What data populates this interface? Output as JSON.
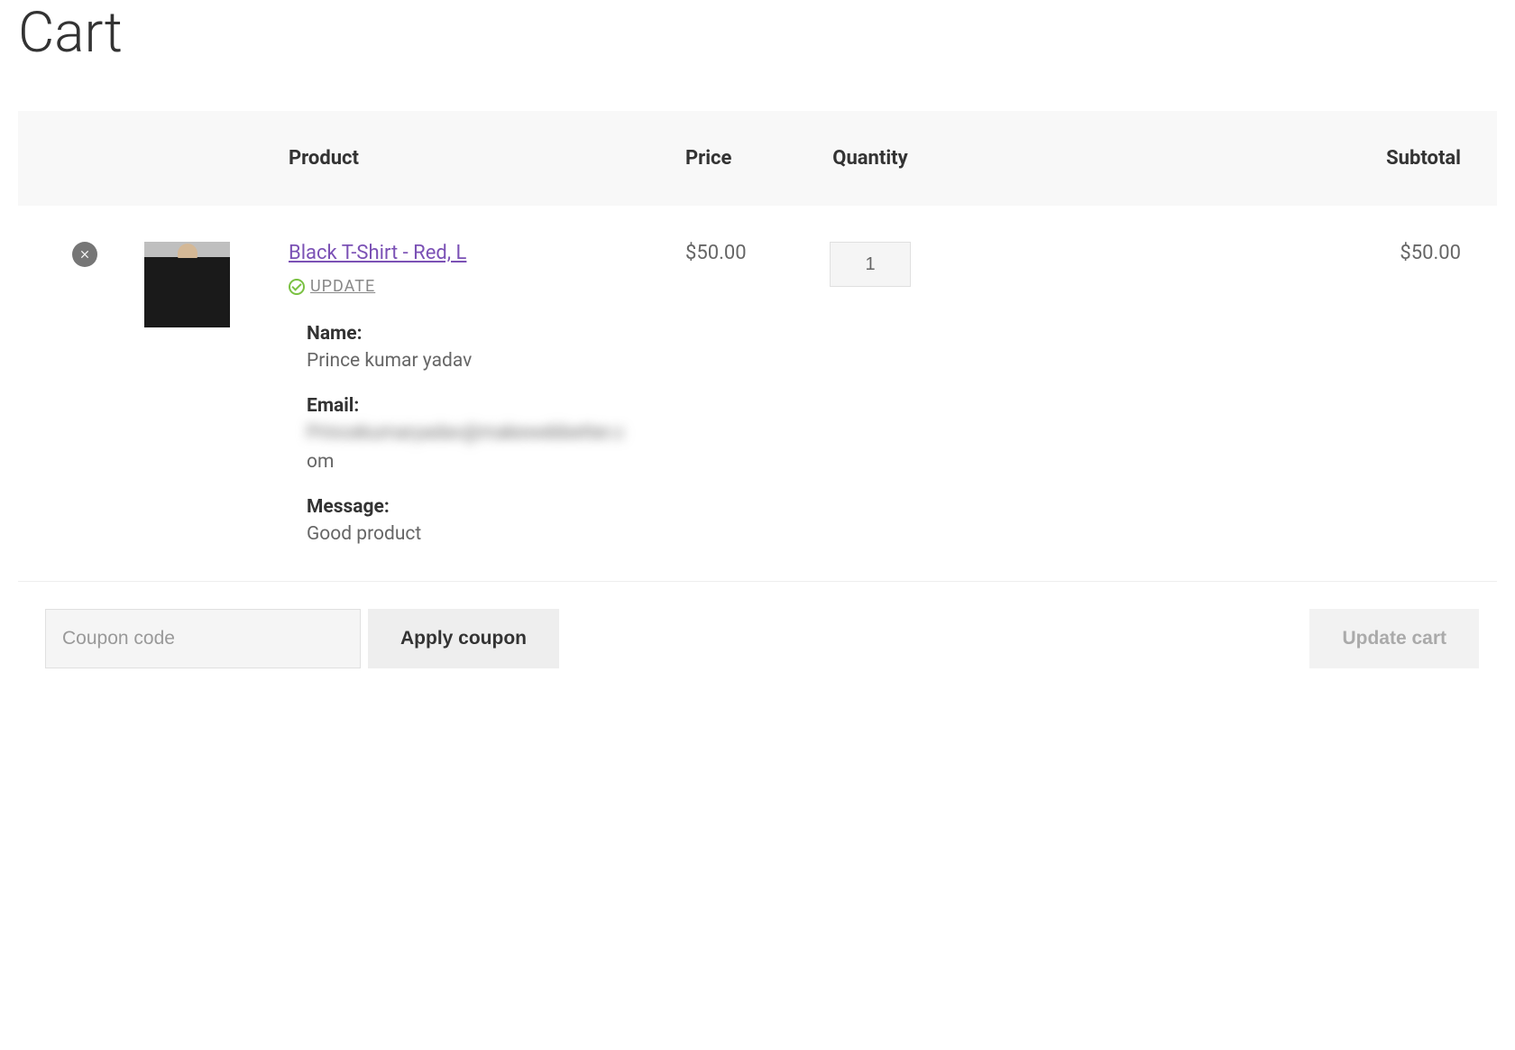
{
  "page": {
    "title": "Cart"
  },
  "table": {
    "headers": {
      "product": "Product",
      "price": "Price",
      "quantity": "Quantity",
      "subtotal": "Subtotal"
    }
  },
  "item": {
    "product_name": "Black T-Shirt - Red, L",
    "update_label": "UPDATE",
    "price": "$50.00",
    "quantity": "1",
    "subtotal": "$50.00",
    "meta": {
      "name_label": "Name:",
      "name_value": "Prince kumar yadav",
      "email_label": "Email:",
      "email_value_line1": "Princekumaryadav@makewebbetter.c",
      "email_value_line2": "om",
      "message_label": "Message:",
      "message_value": "Good product"
    }
  },
  "coupon": {
    "placeholder": "Coupon code",
    "apply_label": "Apply coupon"
  },
  "update_cart_label": "Update cart"
}
